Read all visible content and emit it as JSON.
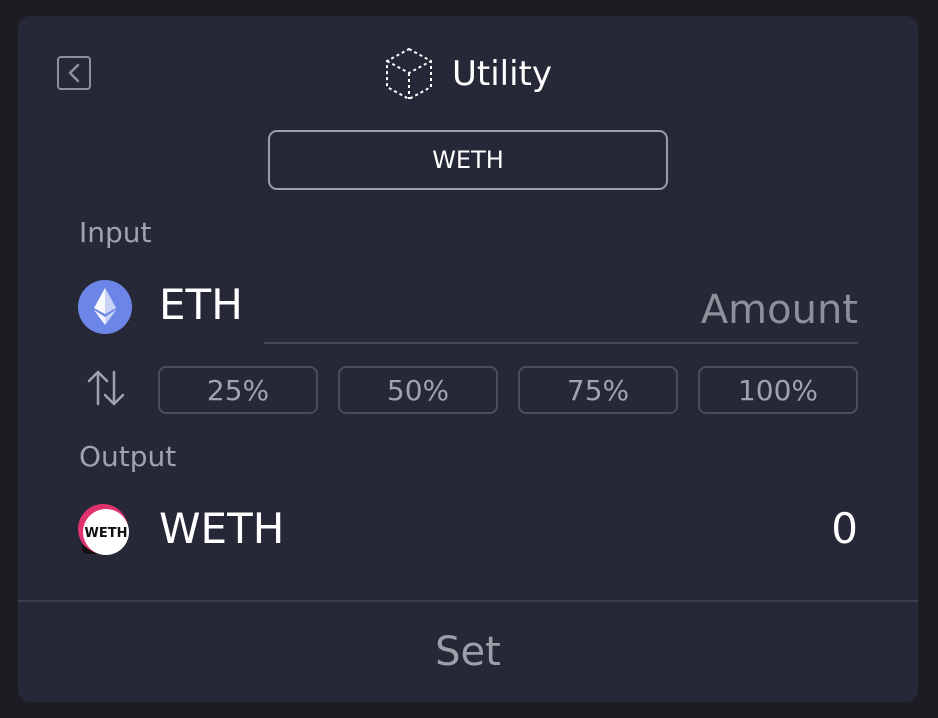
{
  "header": {
    "title": "Utility",
    "back_icon": "chevron-left-icon",
    "title_icon": "cube-icon"
  },
  "token_selector": {
    "label": "WETH"
  },
  "input": {
    "section_label": "Input",
    "token": "ETH",
    "token_icon": "ethereum-icon",
    "amount_placeholder": "Amount",
    "amount_value": ""
  },
  "percent_buttons": [
    "25%",
    "50%",
    "75%",
    "100%"
  ],
  "swap_icon": "swap-vertical-icon",
  "output": {
    "section_label": "Output",
    "token": "WETH",
    "token_icon": "weth-icon",
    "token_icon_text": "WETH",
    "value": "0"
  },
  "footer": {
    "set_label": "Set"
  },
  "colors": {
    "background": "#1c1c22",
    "card": "#262837",
    "text_primary": "#ffffff",
    "text_muted": "#a0a2ac",
    "eth_blue": "#6b86e6",
    "weth_pink": "#e0326e"
  }
}
